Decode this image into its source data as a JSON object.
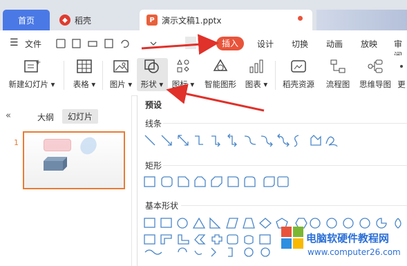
{
  "tabs": {
    "home": "首页",
    "docer": "稻壳",
    "doc": "演示文稿1.pptx"
  },
  "menu": {
    "file": "文件",
    "insert": "插入",
    "design": "设计",
    "transition": "切换",
    "animation": "动画",
    "slideshow": "放映",
    "review": "审阅"
  },
  "ribbon": {
    "new_slide": "新建幻灯片",
    "table": "表格",
    "picture": "图片",
    "shape": "形状",
    "icon": "图标",
    "smart_shape": "智能图形",
    "chart": "图表",
    "docer_resource": "稻壳资源",
    "flowchart": "流程图",
    "mindmap": "思维导图",
    "more": "更"
  },
  "left_panel": {
    "outline_tab": "大纲",
    "slides_tab": "幻灯片",
    "slide_number": "1"
  },
  "dropdown": {
    "preset": "预设",
    "lines": "线条",
    "rectangles": "矩形",
    "basic_shapes": "基本形状"
  },
  "watermark": {
    "title": "电脑软硬件教程网",
    "url": "www.computer26.com"
  },
  "colors": {
    "accent_blue": "#4a79e6",
    "insert_red": "#e8543b",
    "arrow_red": "#e0312a",
    "shape_blue": "#4a86c8",
    "thumb_border": "#e87c35"
  }
}
